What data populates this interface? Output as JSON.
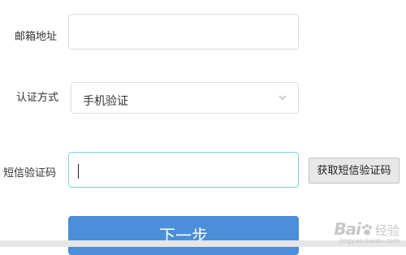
{
  "form": {
    "email_label": "邮箱地址",
    "email_value": "",
    "method_label": "认证方式",
    "method_selected": "手机验证",
    "sms_code_label": "短信验证码",
    "sms_code_value": "",
    "get_sms_code_button": "获取短信验证码",
    "next_button": "下一步"
  },
  "watermark": {
    "brand": "Bai",
    "brand_tail": "经验",
    "url": "jingyan.baidu.com"
  },
  "colors": {
    "primary_button": "#4a8fd8",
    "focused_border": "#7fd3cf"
  },
  "icons": {
    "select_arrow": "chevron-down-icon",
    "watermark_logo": "paw-icon"
  }
}
